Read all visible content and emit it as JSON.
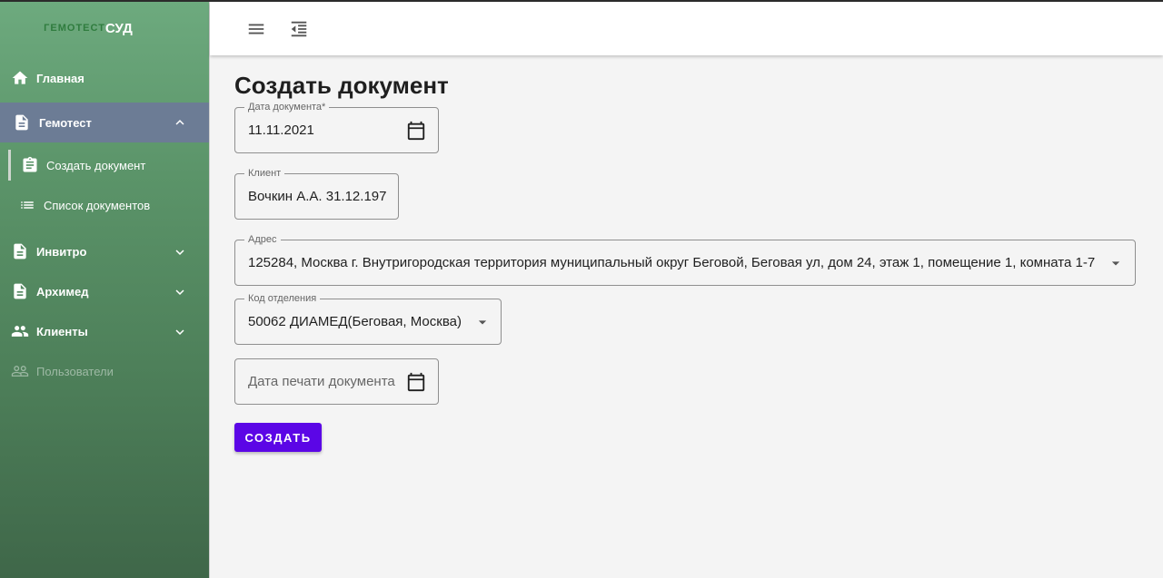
{
  "brand": {
    "part1": "ГЕМОТЕСТ",
    "part2": "СУД"
  },
  "sidebar": {
    "items": [
      {
        "label": "Главная",
        "icon": "home-icon"
      },
      {
        "label": "Гемотест",
        "icon": "document-icon",
        "expanded": true,
        "children": [
          {
            "label": "Создать документ",
            "icon": "clipboard-icon",
            "active": true
          },
          {
            "label": "Список документов",
            "icon": "list-icon"
          }
        ]
      },
      {
        "label": "Инвитро",
        "icon": "document-icon"
      },
      {
        "label": "Архимед",
        "icon": "document-icon"
      },
      {
        "label": "Клиенты",
        "icon": "people-icon"
      },
      {
        "label": "Пользователи",
        "icon": "people-outline-icon",
        "disabled": true
      }
    ]
  },
  "header": {
    "menu_icon": "hamburger-icon",
    "collapse_icon": "collapse-menu-icon"
  },
  "page": {
    "title": "Создать документ",
    "fields": {
      "doc_date": {
        "label": "Дата документа*",
        "value": "11.11.2021"
      },
      "client": {
        "label": "Клиент",
        "value": "Вочкин А.А. 31.12.197"
      },
      "address": {
        "label": "Адрес",
        "value": "125284, Москва г. Внутригородская территория муниципальный округ Беговой, Беговая ул, дом 24, этаж 1, помещение 1, комната 1-7"
      },
      "department": {
        "label": "Код отделения",
        "value": "50062 ДИАМЕД(Беговая, Москва)"
      },
      "print_date": {
        "placeholder": "Дата печати документа"
      }
    },
    "submit_label": "СОЗДАТЬ"
  },
  "colors": {
    "accent": "#5b06e6",
    "sidebar_active": "#6c7c95"
  }
}
